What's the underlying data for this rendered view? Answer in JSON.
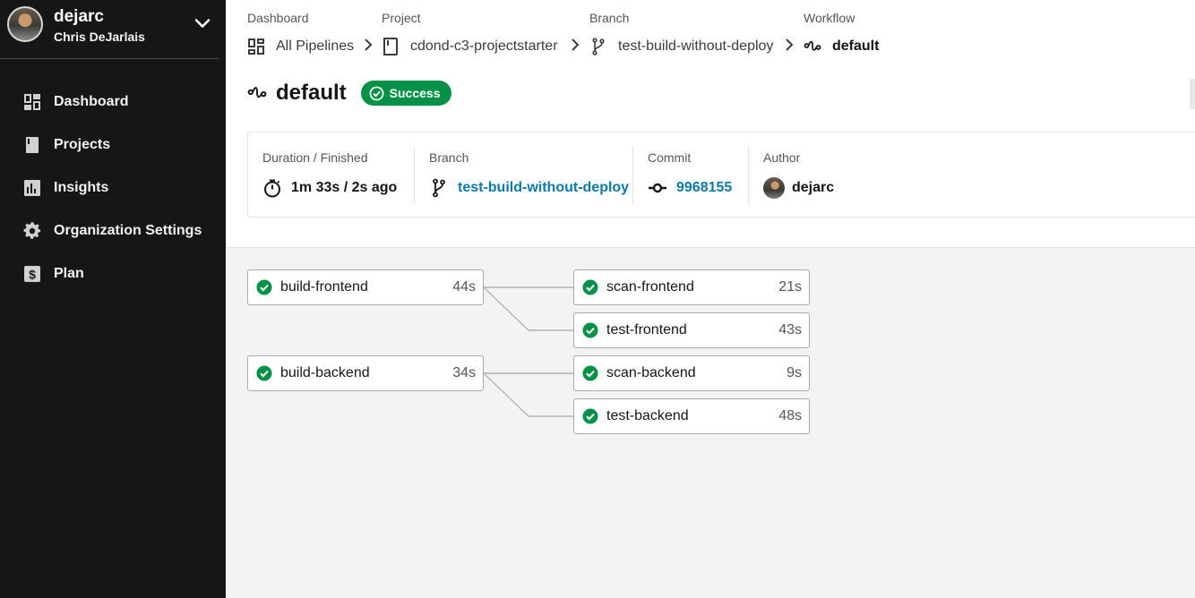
{
  "user": {
    "username": "dejarc",
    "full_name": "Chris DeJarlais"
  },
  "nav": [
    {
      "label": "Dashboard",
      "icon": "dashboard-icon"
    },
    {
      "label": "Projects",
      "icon": "book-icon"
    },
    {
      "label": "Insights",
      "icon": "insights-icon"
    },
    {
      "label": "Organization Settings",
      "icon": "gear-icon"
    },
    {
      "label": "Plan",
      "icon": "dollar-icon"
    }
  ],
  "breadcrumb": {
    "dashboard": {
      "heading": "Dashboard",
      "value": "All Pipelines"
    },
    "project": {
      "heading": "Project",
      "value": "cdond-c3-projectstarter"
    },
    "branch": {
      "heading": "Branch",
      "value": "test-build-without-deploy"
    },
    "workflow": {
      "heading": "Workflow",
      "value": "default"
    }
  },
  "workflow": {
    "title": "default",
    "status": "Success"
  },
  "meta": {
    "duration": {
      "label": "Duration / Finished",
      "value": "1m 33s / 2s ago"
    },
    "branch": {
      "label": "Branch",
      "value": "test-build-without-deploy"
    },
    "commit": {
      "label": "Commit",
      "value": "9968155"
    },
    "author": {
      "label": "Author",
      "value": "dejarc"
    }
  },
  "jobs": [
    {
      "name": "build-frontend",
      "duration": "44s",
      "status": "success"
    },
    {
      "name": "scan-frontend",
      "duration": "21s",
      "status": "success"
    },
    {
      "name": "test-frontend",
      "duration": "43s",
      "status": "success"
    },
    {
      "name": "build-backend",
      "duration": "34s",
      "status": "success"
    },
    {
      "name": "scan-backend",
      "duration": "9s",
      "status": "success"
    },
    {
      "name": "test-backend",
      "duration": "48s",
      "status": "success"
    }
  ],
  "colors": {
    "sidebar_bg": "#161616",
    "success": "#039147",
    "link": "#0b78a6"
  }
}
